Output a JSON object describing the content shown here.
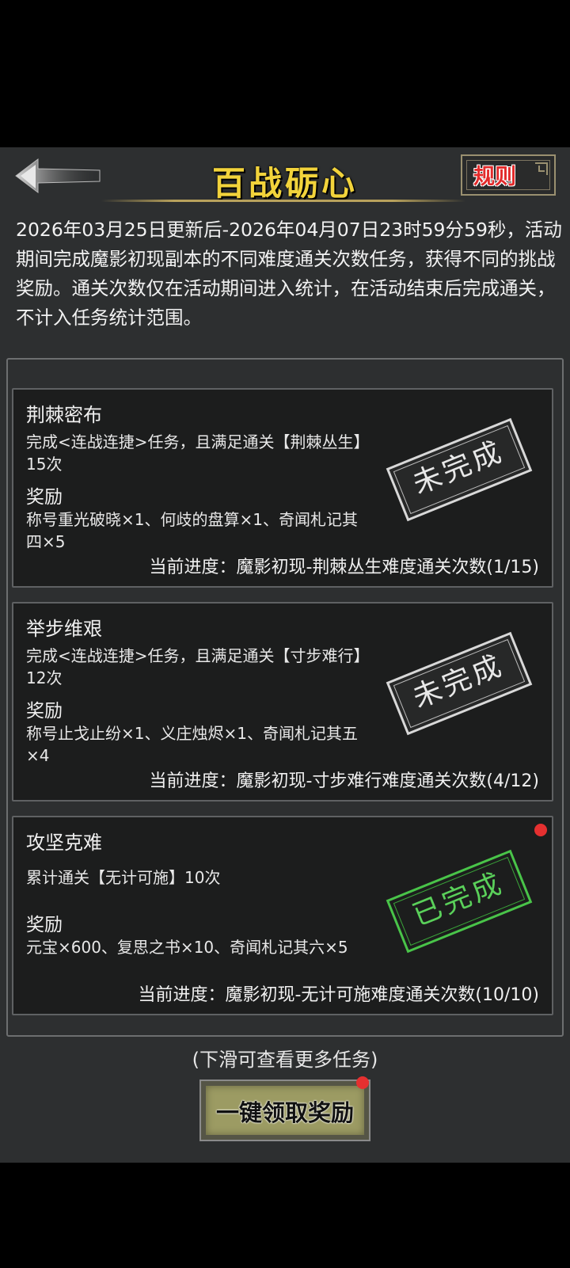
{
  "header": {
    "title": "百战砺心",
    "rule_label": "规则"
  },
  "description": "2026年03月25日更新后-2026年04月07日23时59分59秒，活动期间完成魔影初现副本的不同难度通关次数任务，获得不同的挑战奖励。通关次数仅在活动期间进入统计，在活动结束后完成通关，不计入任务统计范围。",
  "tasks": [
    {
      "title": "荆棘密布",
      "desc": "完成<连战连捷>任务，且满足通关【荆棘丛生】15次",
      "reward_heading": "奖励",
      "reward": "称号重光破晓×1、何歧的盘算×1、奇闻札记其四×5",
      "progress": "当前进度：魔影初现-荆棘丛生难度通关次数(1/15)",
      "status": "未完成"
    },
    {
      "title": "举步维艰",
      "desc": "完成<连战连捷>任务，且满足通关【寸步难行】12次",
      "reward_heading": "奖励",
      "reward": "称号止戈止纷×1、义庄烛烬×1、奇闻札记其五×4",
      "progress": "当前进度：魔影初现-寸步难行难度通关次数(4/12)",
      "status": "未完成"
    },
    {
      "title": "攻坚克难",
      "desc": "累计通关【无计可施】10次",
      "reward_heading": "奖励",
      "reward": "元宝×600、复思之书×10、奇闻札记其六×5",
      "progress": "当前进度：魔影初现-无计可施难度通关次数(10/10)",
      "status": "已完成"
    }
  ],
  "hint": "(下滑可查看更多任务)",
  "claim_button": "一键领取奖励",
  "colors": {
    "title": "#f2d33b",
    "rule_text": "#e22a2a",
    "stamp_done": "#49c449",
    "notification_dot": "#e53030"
  }
}
